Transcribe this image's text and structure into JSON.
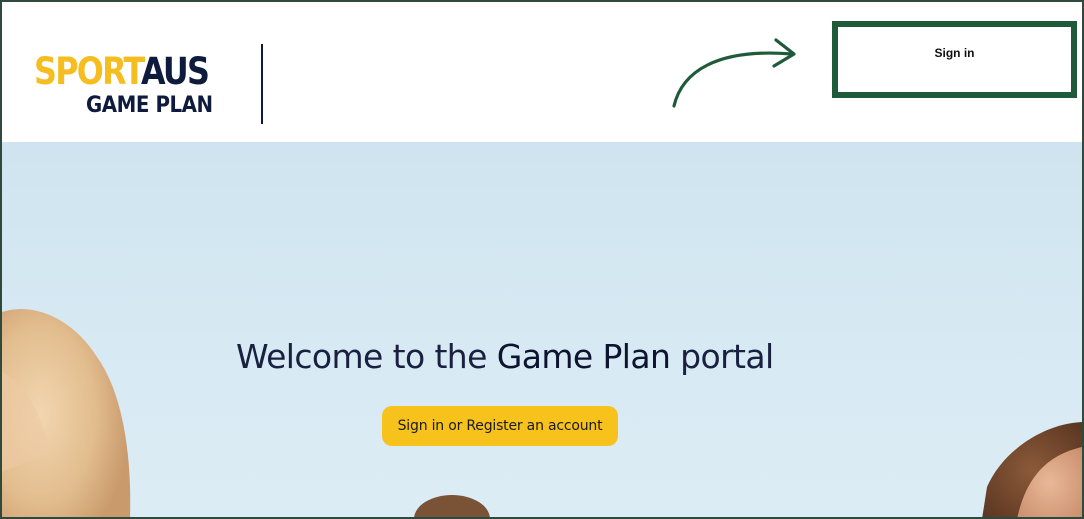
{
  "header": {
    "logo": {
      "sport_text": "SPORT",
      "aus_text": "AUS",
      "subtitle": "GAME PLAN"
    },
    "sign_in_label": "Sign in"
  },
  "hero": {
    "title_part1": "Welcome to the ",
    "title_part2": "Game Plan",
    "title_part3": " portal",
    "cta_label": "Sign in or Register an account"
  },
  "colors": {
    "brand_yellow": "#f5bd1f",
    "brand_navy": "#0e1b3d",
    "highlight_green": "#1f5a3a",
    "cta_yellow": "#f7c21b"
  },
  "icons": {
    "annotation_arrow": "curved-arrow-icon"
  }
}
